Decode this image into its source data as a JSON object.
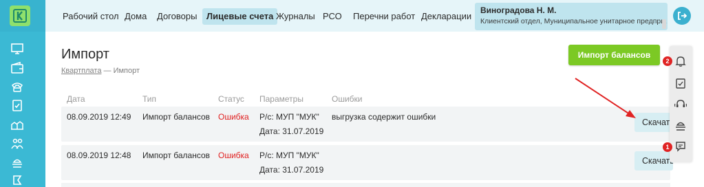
{
  "nav": {
    "items": [
      {
        "label": "Рабочий стол"
      },
      {
        "label": "Дома"
      },
      {
        "label": "Договоры"
      },
      {
        "label": "Лицевые счета",
        "active": true
      },
      {
        "label": "Журналы"
      },
      {
        "label": "РСО"
      },
      {
        "label": "Перечни работ"
      },
      {
        "label": "Декларации"
      }
    ]
  },
  "user": {
    "name": "Виноградова Н. М.",
    "org": "Клиентский отдел, Муниципальное унитарное предпри..."
  },
  "page": {
    "title": "Импорт",
    "breadcrumb_link": "Квартплата",
    "breadcrumb_sep": "—",
    "breadcrumb_current": "Импорт",
    "import_button": "Импорт балансов"
  },
  "table": {
    "headers": [
      "Дата",
      "Тип",
      "Статус",
      "Параметры",
      "Ошибки"
    ],
    "rows": [
      {
        "date": "08.09.2019 12:49",
        "type": "Импорт балансов",
        "status": "Ошибка",
        "param1": "Р/с: МУП \"МУК\"",
        "param2": "Дата: 31.07.2019",
        "errors": "выгрузка содержит ошибки",
        "download": "Скачать"
      },
      {
        "date": "08.09.2019 12:48",
        "type": "Импорт балансов",
        "status": "Ошибка",
        "param1": "Р/с: МУП \"МУК\"",
        "param2": "Дата: 31.07.2019",
        "errors": "",
        "download": "Скачать"
      }
    ]
  },
  "side_panel": {
    "bell_badge": "2",
    "chat_badge": "1"
  },
  "colors": {
    "brand": "#3bb9d4",
    "accent_green": "#7cc924",
    "error_red": "#e02020",
    "badge_red": "#e02424"
  }
}
